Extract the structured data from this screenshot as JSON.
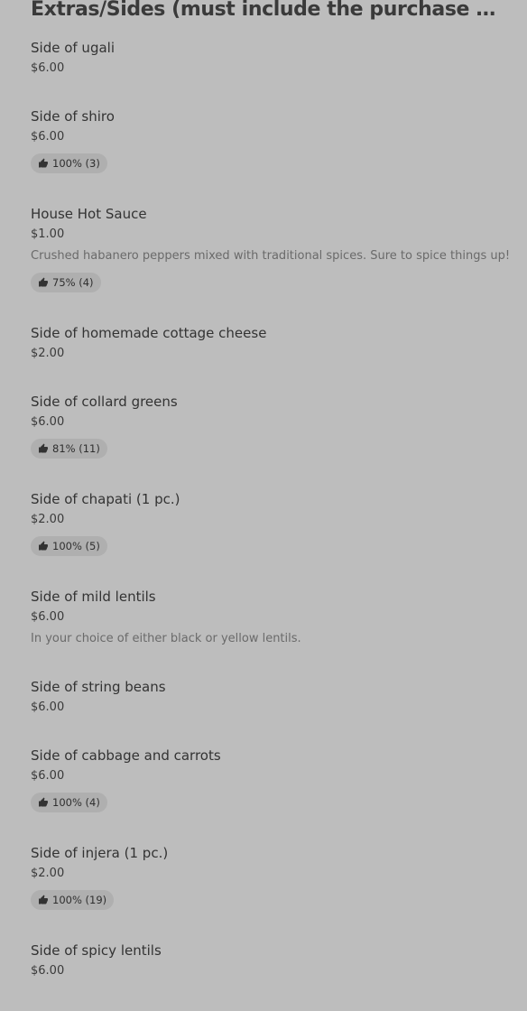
{
  "section": {
    "title": "Extras/Sides (must include the purchase of an..."
  },
  "items": [
    {
      "name": "Side of ugali",
      "price": "$6.00"
    },
    {
      "name": "Side of shiro",
      "price": "$6.00",
      "rating": "100% (3)"
    },
    {
      "name": "House Hot Sauce",
      "price": "$1.00",
      "description": "Crushed habanero peppers mixed with traditional spices. Sure to spice things up!",
      "rating": "75% (4)"
    },
    {
      "name": "Side of homemade cottage cheese",
      "price": "$2.00"
    },
    {
      "name": "Side of collard greens",
      "price": "$6.00",
      "rating": "81% (11)"
    },
    {
      "name": "Side of chapati (1 pc.)",
      "price": "$2.00",
      "rating": "100% (5)"
    },
    {
      "name": "Side of mild lentils",
      "price": "$6.00",
      "description": "In your choice of either black or yellow lentils."
    },
    {
      "name": "Side of string beans",
      "price": "$6.00"
    },
    {
      "name": "Side of cabbage and carrots",
      "price": "$6.00",
      "rating": "100% (4)"
    },
    {
      "name": "Side of injera (1 pc.)",
      "price": "$2.00",
      "rating": "100% (19)"
    },
    {
      "name": "Side of spicy lentils",
      "price": "$6.00"
    }
  ],
  "icons": {
    "rating": "thumbs-up-icon"
  }
}
